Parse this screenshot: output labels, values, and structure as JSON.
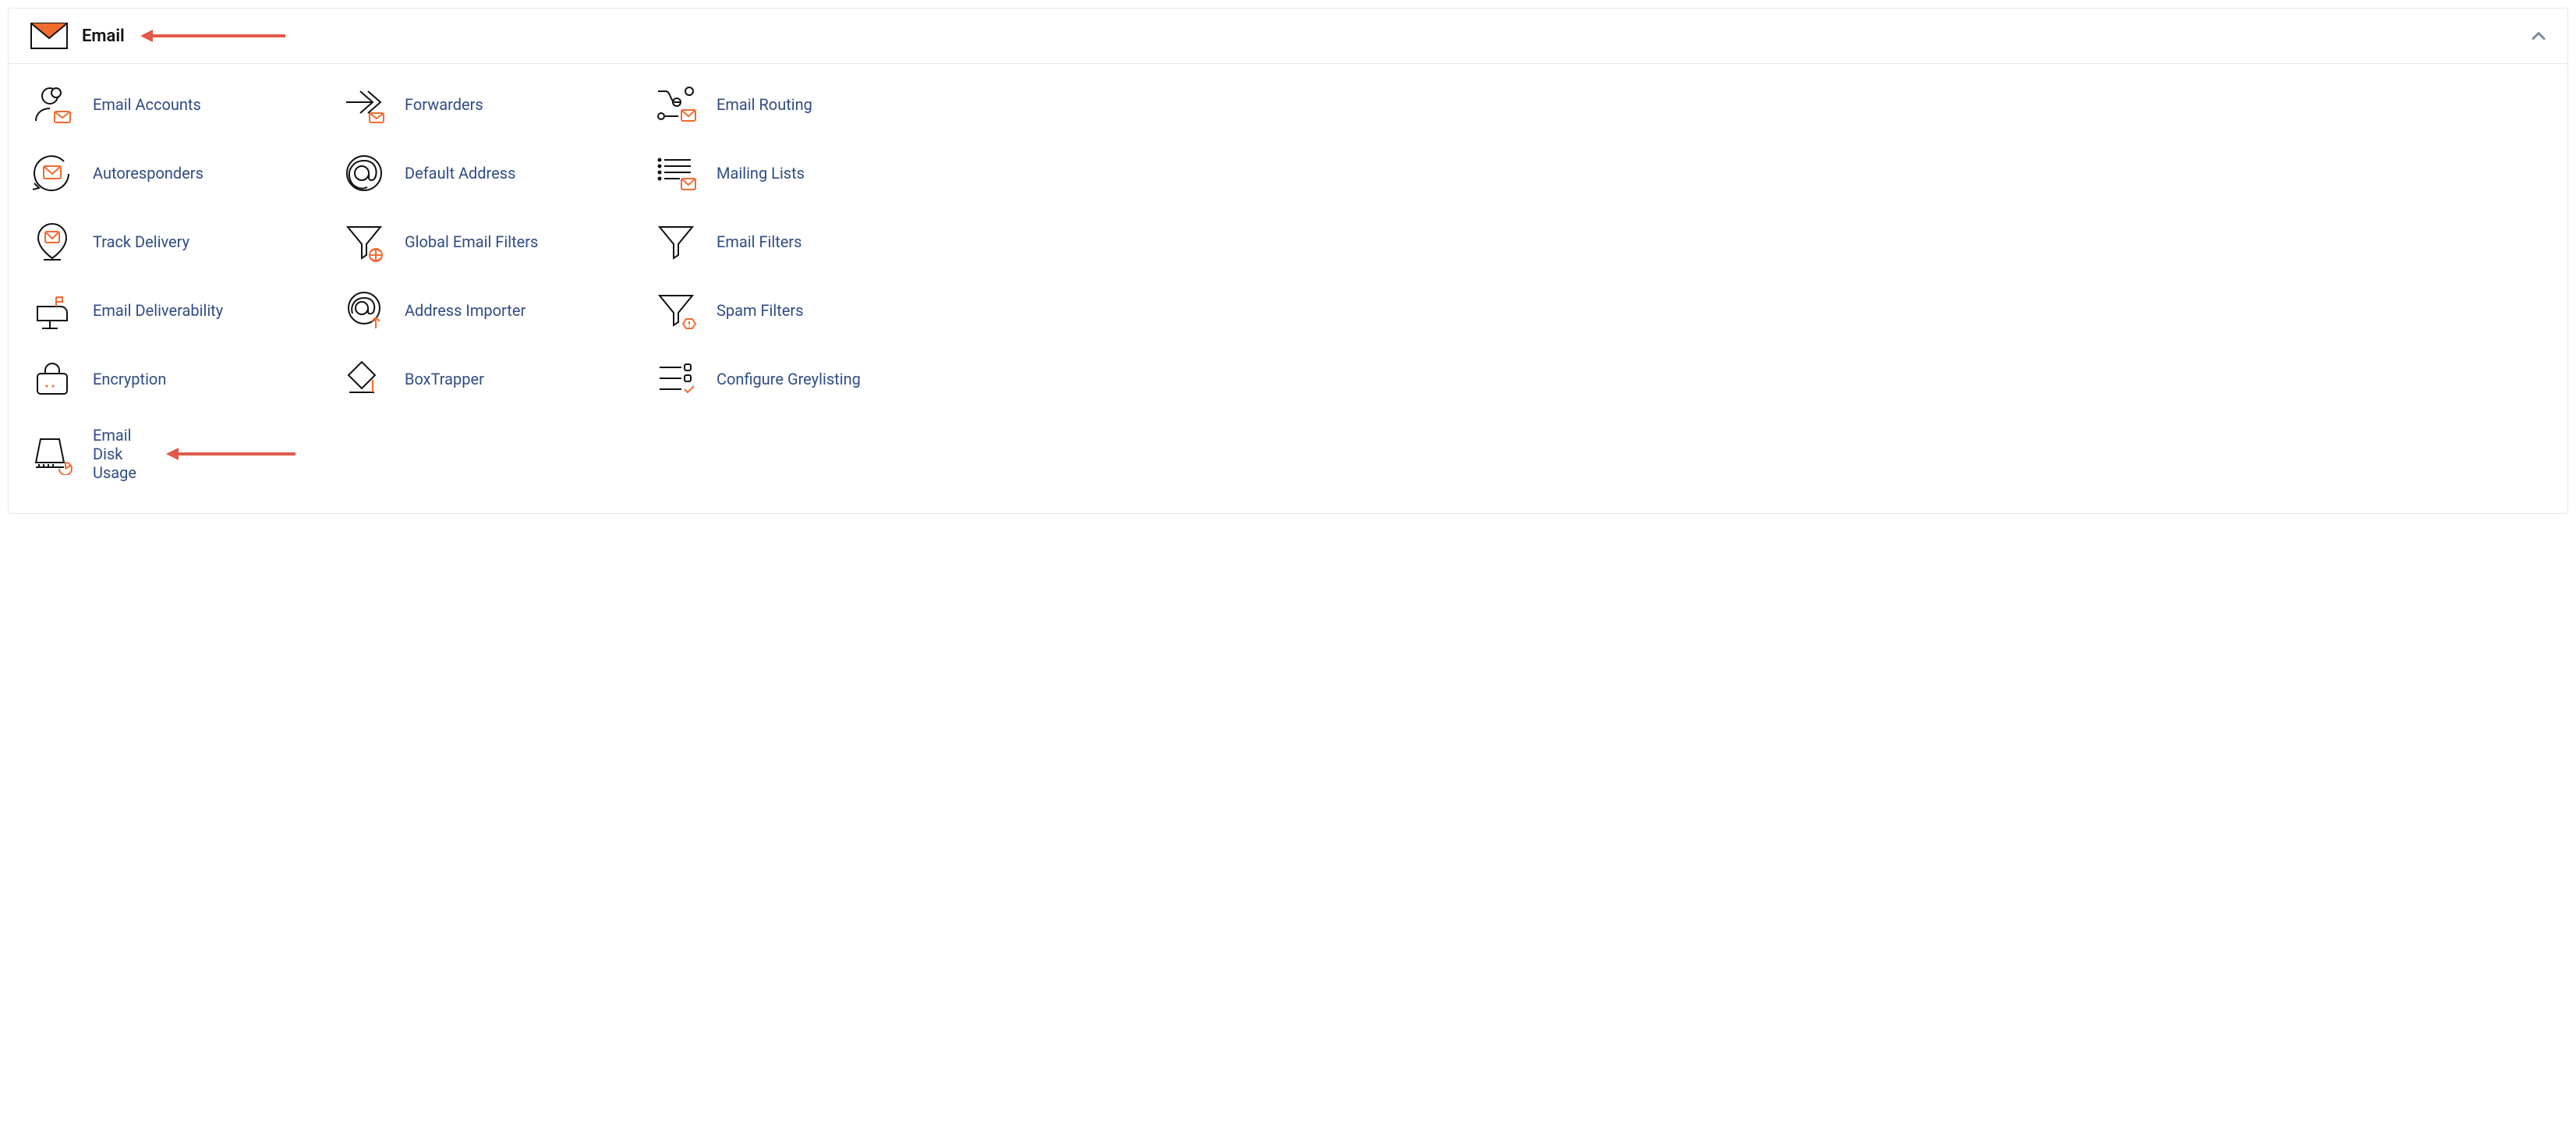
{
  "panel": {
    "title": "Email",
    "collapsed": false
  },
  "items": [
    {
      "label": "Email Accounts",
      "icon": "email-accounts-icon"
    },
    {
      "label": "Forwarders",
      "icon": "forwarders-icon"
    },
    {
      "label": "Email Routing",
      "icon": "email-routing-icon"
    },
    {
      "label": "Autoresponders",
      "icon": "autoresponders-icon"
    },
    {
      "label": "Default Address",
      "icon": "default-address-icon"
    },
    {
      "label": "Mailing Lists",
      "icon": "mailing-lists-icon"
    },
    {
      "label": "Track Delivery",
      "icon": "track-delivery-icon"
    },
    {
      "label": "Global Email Filters",
      "icon": "global-email-filters-icon"
    },
    {
      "label": "Email Filters",
      "icon": "email-filters-icon"
    },
    {
      "label": "Email Deliverability",
      "icon": "email-deliverability-icon"
    },
    {
      "label": "Address Importer",
      "icon": "address-importer-icon"
    },
    {
      "label": "Spam Filters",
      "icon": "spam-filters-icon"
    },
    {
      "label": "Encryption",
      "icon": "encryption-icon"
    },
    {
      "label": "BoxTrapper",
      "icon": "boxtrapper-icon"
    },
    {
      "label": "Configure Greylisting",
      "icon": "configure-greylisting-icon"
    },
    {
      "label": "Email Disk Usage",
      "icon": "email-disk-usage-icon"
    }
  ],
  "colors": {
    "link": "#2f4c84",
    "accent": "#f26a2e",
    "arrow": "#e05a4a",
    "icon_stroke": "#111"
  }
}
